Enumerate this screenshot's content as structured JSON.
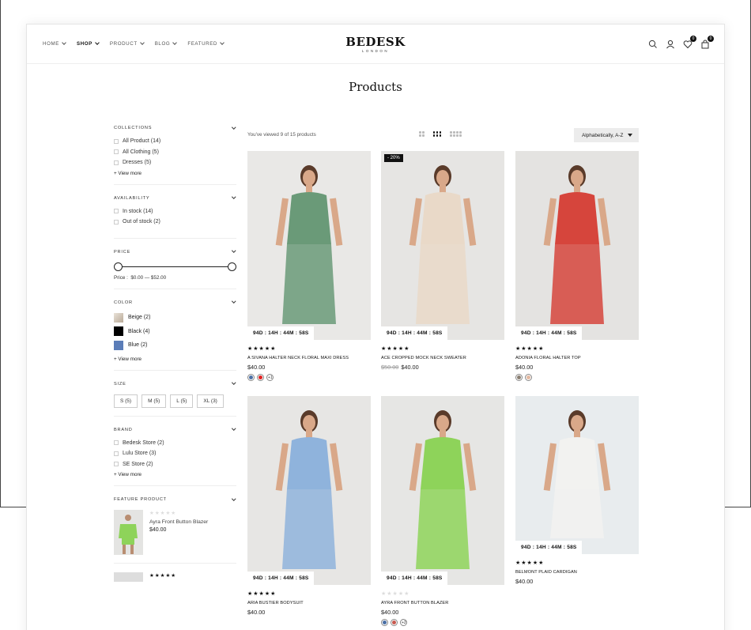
{
  "header": {
    "nav": [
      "HOME",
      "SHOP",
      "PRODUCT",
      "BLOG",
      "FEATURED"
    ],
    "active_nav": "SHOP",
    "logo": "BEDESK",
    "logo_sub": "LONDON",
    "wishlist_count": "0",
    "cart_count": "0",
    "icons": [
      "search-icon",
      "user-icon",
      "heart-icon",
      "bag-icon"
    ]
  },
  "page_title": "Products",
  "filters": {
    "collections": {
      "title": "COLLECTIONS",
      "options": [
        "All Product (14)",
        "All Clothing (5)",
        "Dresses (5)"
      ],
      "view_more": "+ View more"
    },
    "availability": {
      "title": "AVAILABILITY",
      "options": [
        "In stock (14)",
        "Out of stock (2)"
      ]
    },
    "price": {
      "title": "PRICE",
      "label": "Price :",
      "range": "$0.00 — $52.00"
    },
    "color": {
      "title": "COLOR",
      "options": [
        {
          "label": "Beige (2)",
          "color": "#cdbfae"
        },
        {
          "label": "Black (4)",
          "color": "#000000"
        },
        {
          "label": "Blue (2)",
          "color": "#5b7db8"
        }
      ],
      "view_more": "+ View more"
    },
    "size": {
      "title": "SIZE",
      "options": [
        "S (5)",
        "M (5)",
        "L (5)",
        "XL (3)"
      ]
    },
    "brand": {
      "title": "BRAND",
      "options": [
        "Bedesk Store (2)",
        "Lulu Store (3)",
        "SE Store (2)"
      ],
      "view_more": "+ View more"
    },
    "feature": {
      "title": "FEATURE PRODUCT",
      "name": "Ayra Front Button Blazer",
      "price": "$40.00",
      "stars": "★★★★★",
      "next_stars": "★★★★★"
    }
  },
  "toolbar": {
    "viewed": "You've viewed 9 of 15 products",
    "sort": "Alphabetically, A-Z"
  },
  "products": [
    {
      "name": "A SIVANA HALTER NECK FLORAL MAXI DRESS",
      "price": "$40.00",
      "old_price": "",
      "badge": "",
      "timer": "94D : 14H : 44M : 58S",
      "stars": "★★★★★",
      "rated": true,
      "swatches": [
        "#4a6fa5",
        "#e02020"
      ],
      "more": "+1",
      "bg": "#e9e8e6",
      "cloth": "#6a9a78"
    },
    {
      "name": "ACE CROPPED MOCK NECK SWEATER",
      "price": "$40.00",
      "old_price": "$50.00",
      "badge": "- 20%",
      "timer": "94D : 14H : 44M : 58S",
      "stars": "★★★★★",
      "rated": true,
      "swatches": [],
      "more": "",
      "bg": "#e6e5e3",
      "cloth": "#e9d9c8"
    },
    {
      "name": "ADONIA FLORAL HALTER TOP",
      "price": "$40.00",
      "old_price": "",
      "badge": "",
      "timer": "94D : 14H : 44M : 58S",
      "stars": "★★★★★",
      "rated": true,
      "swatches": [
        "#8a7f72",
        "#e3b8a0"
      ],
      "more": "",
      "bg": "#e4e3e1",
      "cloth": "#d6453c"
    },
    {
      "name": "ARIA BUSTIER BODYSUIT",
      "price": "$40.00",
      "old_price": "",
      "badge": "",
      "timer": "94D : 14H : 44M : 58S",
      "stars": "★★★★★",
      "rated": true,
      "swatches": [],
      "more": "",
      "bg": "#e7e6e4",
      "cloth": "#8fb3dc"
    },
    {
      "name": "AYRA FRONT BUTTON BLAZER",
      "price": "$40.00",
      "old_price": "",
      "badge": "",
      "timer": "94D : 14H : 44M : 58S",
      "stars": "★★★★★",
      "rated": false,
      "swatches": [
        "#4a6fa5",
        "#c85a50"
      ],
      "more": "+2",
      "bg": "#e6e6e4",
      "cloth": "#8ed35a"
    },
    {
      "name": "BELMONT PLAID CARDIGAN",
      "price": "$40.00",
      "old_price": "",
      "badge": "",
      "timer": "94D : 14H : 44M : 58S",
      "stars": "★★★★★",
      "rated": true,
      "swatches": [],
      "more": "",
      "bg": "#e8ecee",
      "cloth": "#f2f2f0"
    }
  ]
}
